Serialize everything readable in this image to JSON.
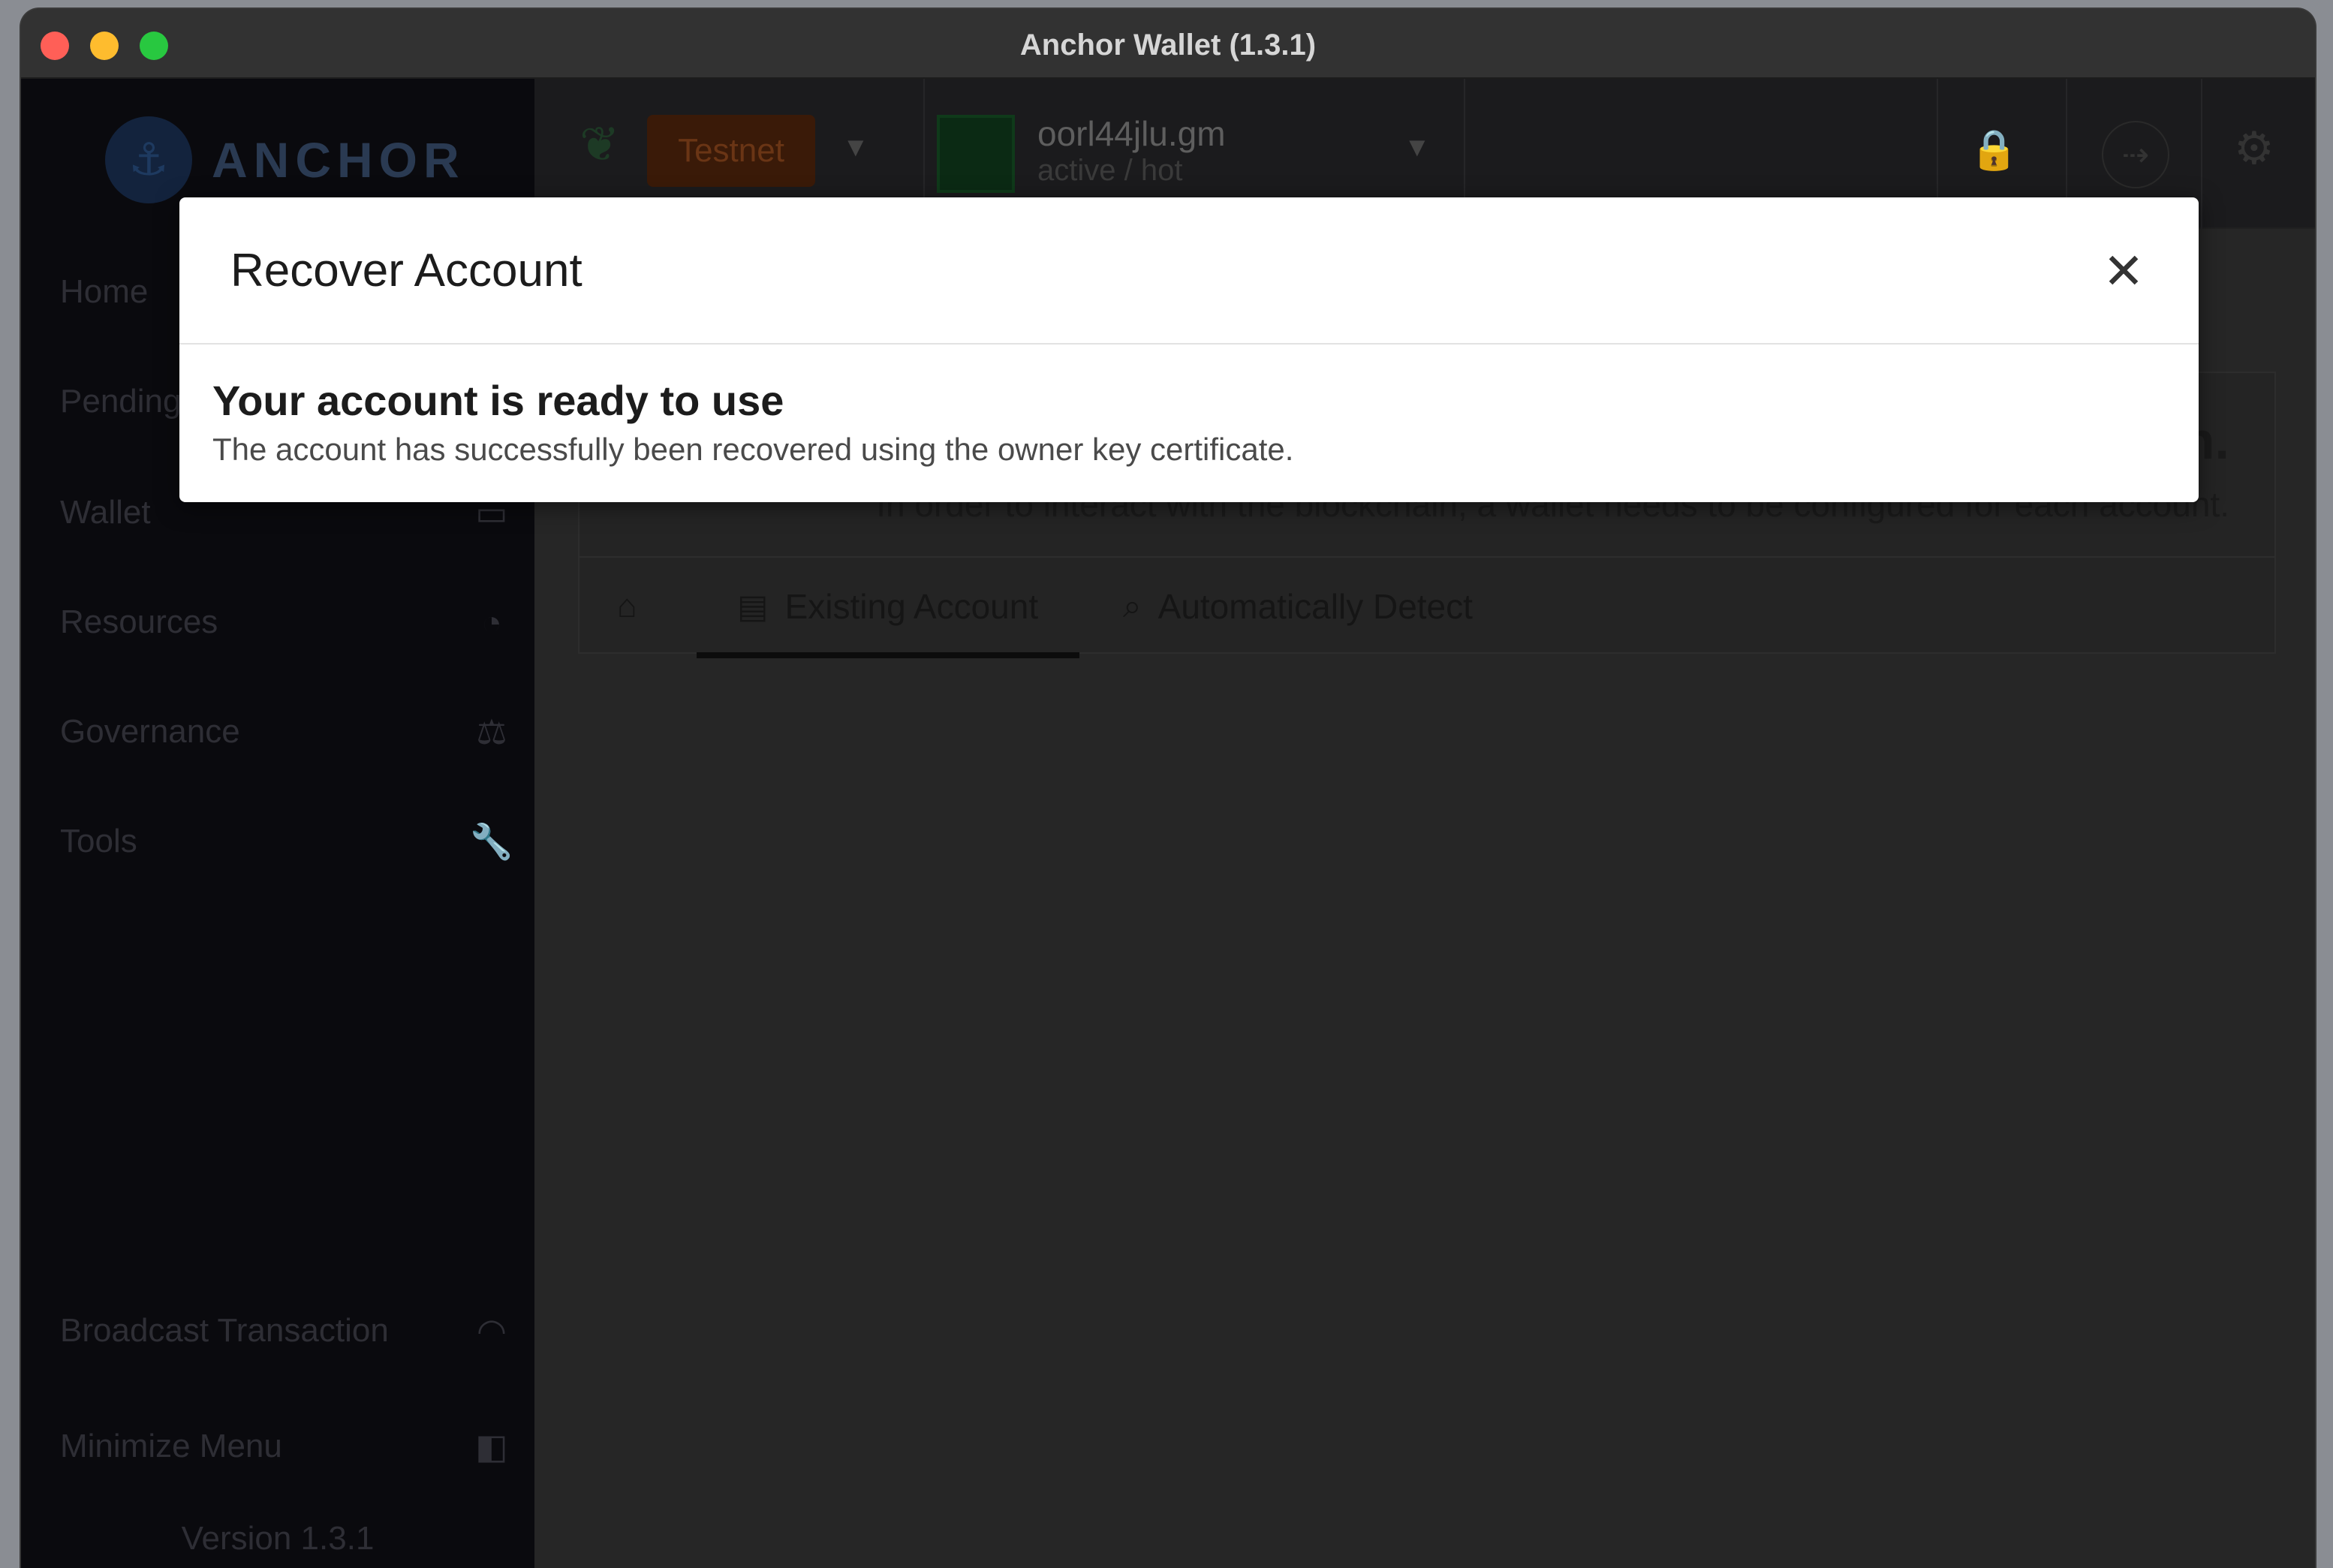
{
  "window": {
    "title": "Anchor Wallet (1.3.1)"
  },
  "sidebar": {
    "brand": "ANCHOR",
    "items": [
      {
        "label": "Home",
        "icon": "home-icon"
      },
      {
        "label": "Pending",
        "icon": "pending-icon"
      },
      {
        "label": "Wallet",
        "icon": "wallet-icon"
      },
      {
        "label": "Resources",
        "icon": "dashboard-icon"
      },
      {
        "label": "Governance",
        "icon": "balance-scale-icon"
      },
      {
        "label": "Tools",
        "icon": "wrench-icon"
      }
    ],
    "broadcast": {
      "label": "Broadcast Transaction",
      "icon": "wifi-icon"
    },
    "minimize": {
      "label": "Minimize Menu",
      "icon": "caret-left-square-icon"
    },
    "version": "Version 1.3.1"
  },
  "topbar": {
    "network": "Testnet",
    "account": {
      "name": "oorl44jlu.gm",
      "permission": "active / hot"
    }
  },
  "background": {
    "headline": "n.",
    "text": "In order to interact with the blockchain, a wallet needs to be configured for each account."
  },
  "tabs": [
    {
      "label": "",
      "icon": "home-icon"
    },
    {
      "label": "Existing Account",
      "icon": "id-card-icon",
      "active": true
    },
    {
      "label": "Automatically Detect",
      "icon": "search-icon"
    }
  ],
  "modal": {
    "title": "Recover Account",
    "heading": "Your account is ready to use",
    "description": "The account has successfully been recovered using the owner key certificate."
  }
}
